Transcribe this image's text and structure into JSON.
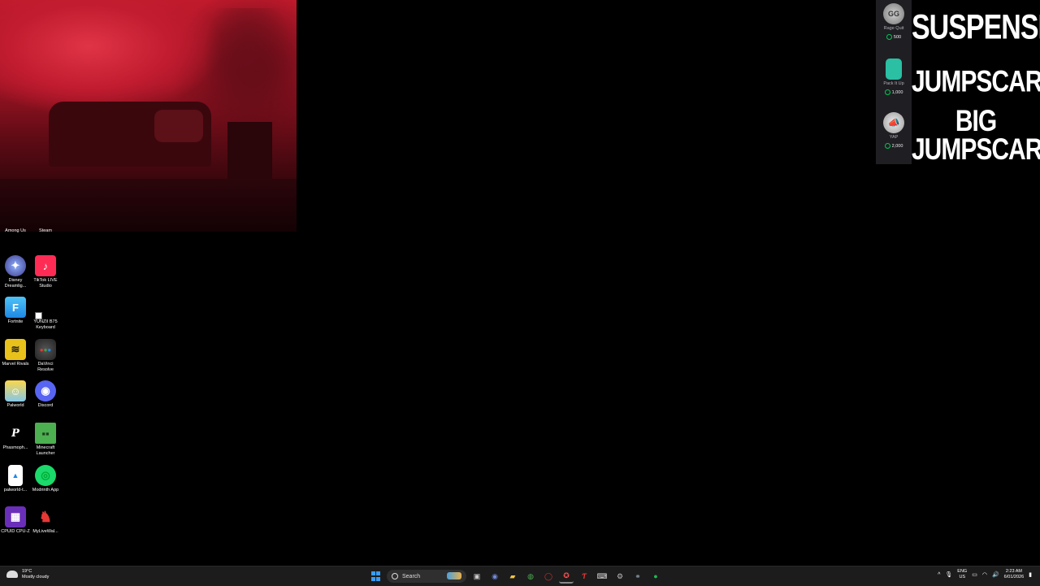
{
  "desktop": {
    "icons": [
      {
        "label": "Among Us",
        "name": "among-us-icon"
      },
      {
        "label": "Steam",
        "name": "steam-icon"
      },
      {
        "label": "Disney Dreamlig...",
        "name": "disney-dreamlight-icon"
      },
      {
        "label": "TikTok LIVE Studio",
        "name": "tiktok-live-studio-icon"
      },
      {
        "label": "Fortnite",
        "name": "fortnite-icon"
      },
      {
        "label": "YUNZII B75 Keyboard",
        "name": "yunzii-keyboard-icon"
      },
      {
        "label": "Marvel Rivals",
        "name": "marvel-rivals-icon"
      },
      {
        "label": "DaVinci Resolve",
        "name": "davinci-resolve-icon"
      },
      {
        "label": "Palworld",
        "name": "palworld-icon"
      },
      {
        "label": "Discord",
        "name": "discord-icon"
      },
      {
        "label": "Phasmoph...",
        "name": "phasmophobia-icon"
      },
      {
        "label": "Minecraft Launcher",
        "name": "minecraft-launcher-icon"
      },
      {
        "label": "palworld-t...",
        "name": "palworld-file-icon"
      },
      {
        "label": "Modrinth App",
        "name": "modrinth-app-icon"
      },
      {
        "label": "CPUID CPU-Z",
        "name": "cpu-z-icon"
      },
      {
        "label": "MyLiveWal...",
        "name": "mylivewallpaper-icon"
      }
    ]
  },
  "rewards": [
    {
      "title": "Rage Quit",
      "cost": "500",
      "name": "rage-quit-reward"
    },
    {
      "title": "Pack It Up",
      "cost": "1,000",
      "name": "pack-it-up-reward"
    },
    {
      "title": "YAP",
      "cost": "2,000",
      "name": "yap-reward"
    }
  ],
  "alerts": {
    "suspense": "SUSPENSE",
    "jumpscare": "JUMPSCARE",
    "big_line1": "BIG",
    "big_line2": "JUMPSCARE"
  },
  "taskbar": {
    "weather_temp": "19°C",
    "weather_desc": "Mostly cloudy",
    "search_placeholder": "Search",
    "lang_line1": "ENG",
    "lang_line2": "US",
    "time": "2:23 AM",
    "date": "6/01/2026"
  },
  "colors": {
    "taskbar_bg": "#1c1c1c",
    "rewards_bg": "#1f1f23",
    "points_green": "#00c853",
    "windows_blue": "#3a9bf5"
  }
}
